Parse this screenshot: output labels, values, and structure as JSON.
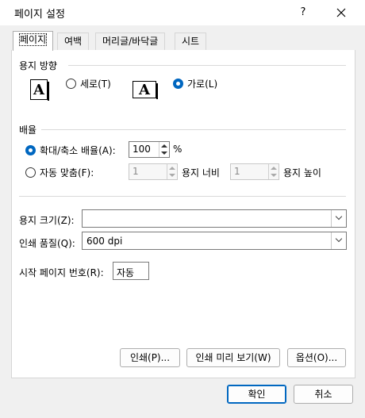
{
  "window": {
    "title": "페이지 설정",
    "help_label": "?",
    "close_label": "✕"
  },
  "tabs": [
    {
      "label": "페이지"
    },
    {
      "label": "여백"
    },
    {
      "label": "머리글/바닥글"
    },
    {
      "label": "시트"
    }
  ],
  "orientation": {
    "heading": "용지 방향",
    "portrait_icon": "A",
    "portrait_label": "세로(T)",
    "landscape_icon": "A",
    "landscape_label": "가로(L)",
    "selected": "landscape"
  },
  "scaling": {
    "heading": "배율",
    "adjust_label": "확대/축소 배율(A):",
    "adjust_value": "100",
    "percent_sign": "%",
    "fit_label": "자동 맞춤(F):",
    "fit_wide_value": "1",
    "fit_wide_label": "용지 너비",
    "fit_tall_value": "1",
    "fit_tall_label": "용지 높이",
    "selected": "adjust"
  },
  "paper_size": {
    "label": "용지 크기(Z):",
    "value": ""
  },
  "print_quality": {
    "label": "인쇄 품질(Q):",
    "value": "600 dpi"
  },
  "first_page": {
    "label": "시작 페이지 번호(R):",
    "value": "자동"
  },
  "panel_buttons": {
    "print": "인쇄(P)...",
    "preview": "인쇄 미리 보기(W)",
    "options": "옵션(O)..."
  },
  "footer_buttons": {
    "ok": "확인",
    "cancel": "취소"
  },
  "colors": {
    "accent": "#0067c0",
    "background": "#f0f0f0",
    "panel": "#ffffff"
  }
}
